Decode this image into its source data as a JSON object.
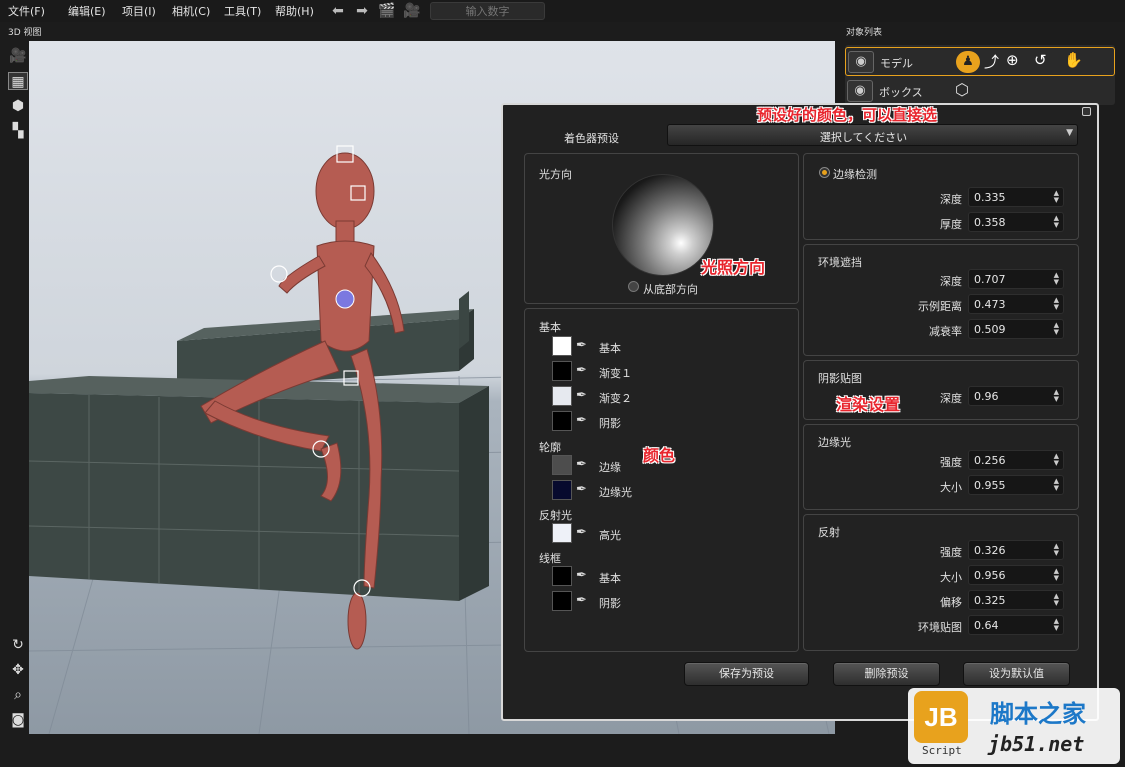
{
  "menu": [
    {
      "label": "文件(F)"
    },
    {
      "label": "编辑(E)"
    },
    {
      "label": "项目(I)"
    },
    {
      "label": "相机(C)"
    },
    {
      "label": "工具(T)"
    },
    {
      "label": "帮助(H)"
    }
  ],
  "toolbar": {
    "number_input_placeholder": "输入数字"
  },
  "viewport": {
    "title": "3D 视图"
  },
  "object_list": {
    "title": "对象列表",
    "items": [
      {
        "name": "モデル"
      },
      {
        "name": "ボックス"
      }
    ]
  },
  "shader": {
    "preset_label": "着色器预设",
    "preset_value": "選択してください",
    "light": {
      "title": "光方向",
      "from_bottom": "从底部方向"
    },
    "colors": {
      "basic_title": "基本",
      "basic": {
        "label": "基本",
        "color": "#ffffff"
      },
      "grad1": {
        "label": "渐变１",
        "color": "#000000"
      },
      "grad2": {
        "label": "渐变２",
        "color": "#e6e9ef"
      },
      "shadow": {
        "label": "阴影",
        "color": "#000000"
      },
      "outline_title": "轮廓",
      "edge": {
        "label": "边缘",
        "color": "#4d4d4d"
      },
      "rim": {
        "label": "边缘光",
        "color": "#070a2e"
      },
      "reflect_title": "反射光",
      "highlight": {
        "label": "高光",
        "color": "#eef1f8"
      },
      "wire_title": "线框",
      "wire_basic": {
        "label": "基本",
        "color": "#000000"
      },
      "wire_shadow": {
        "label": "阴影",
        "color": "#000000"
      }
    },
    "edge_detect": {
      "label": "边缘检测",
      "depth_label": "深度",
      "depth": "0.335",
      "thickness_label": "厚度",
      "thickness": "0.358"
    },
    "ao": {
      "title": "环境遮挡",
      "depth_label": "深度",
      "depth": "0.707",
      "dist_label": "示例距离",
      "dist": "0.473",
      "decay_label": "减衰率",
      "decay": "0.509"
    },
    "shadow_map": {
      "title": "阴影贴图",
      "depth_label": "深度",
      "depth": "0.96"
    },
    "rim_light": {
      "title": "边缘光",
      "strength_label": "强度",
      "strength": "0.256",
      "size_label": "大小",
      "size": "0.955"
    },
    "reflection": {
      "title": "反射",
      "strength_label": "强度",
      "strength": "0.326",
      "size_label": "大小",
      "size": "0.956",
      "offset_label": "偏移",
      "offset": "0.325",
      "env_label": "环境贴图",
      "env": "0.64"
    },
    "buttons": {
      "save": "保存为预设",
      "delete": "删除预设",
      "default": "设为默认值"
    }
  },
  "annotations": {
    "preset_note": "预设好的颜色，可以直接选",
    "light_note": "光照方向",
    "render_note": "渲染设置",
    "color_note": "颜色"
  },
  "watermark": {
    "logo_letter": "JB",
    "logo_sub": "Script",
    "site": "脚本之家",
    "url": "jb51.net"
  },
  "accent_color": "#e8a21d"
}
